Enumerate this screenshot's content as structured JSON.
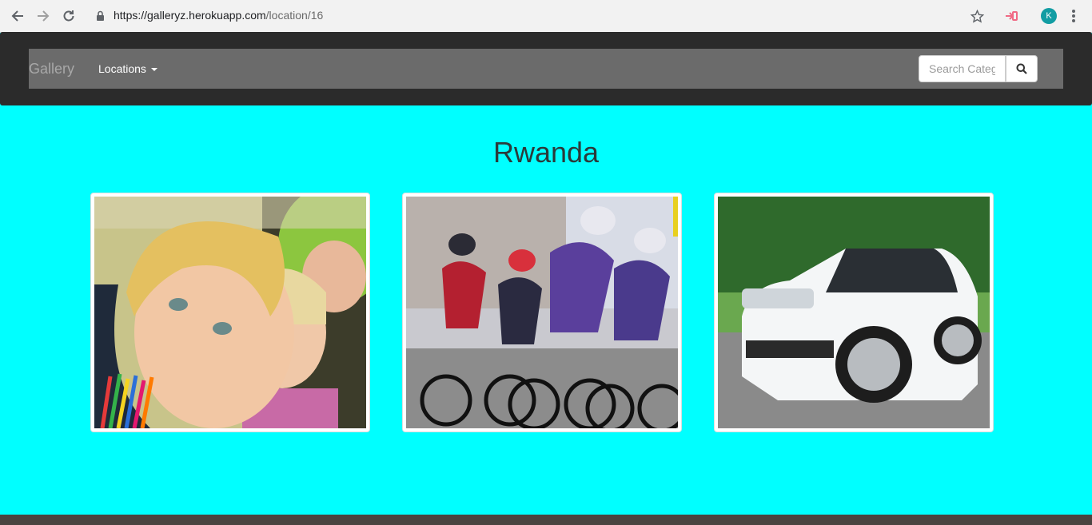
{
  "browser": {
    "url_host": "https://galleryz.herokuapp.com",
    "url_path": "/location/16",
    "profile_initial": "K"
  },
  "navbar": {
    "brand": "Gallery",
    "locations_label": "Locations",
    "search_placeholder": "Search Category"
  },
  "page": {
    "title": "Rwanda"
  },
  "gallery": {
    "images": [
      {
        "subject": "children-with-colored-pencils"
      },
      {
        "subject": "road-cyclists-racing"
      },
      {
        "subject": "white-suv-car"
      }
    ]
  },
  "colors": {
    "page_background": "#00ffff",
    "navbar_background": "#2b2b2b",
    "navbar_inner": "#6b6b6b"
  }
}
